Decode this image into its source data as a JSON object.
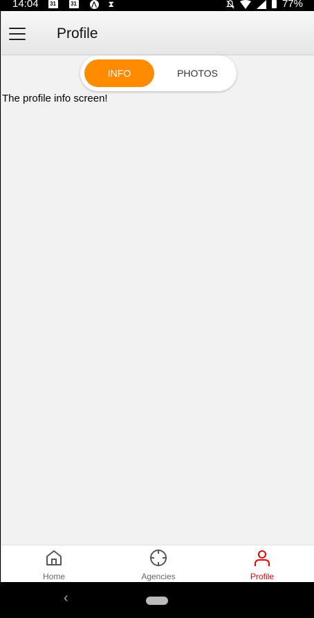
{
  "status_bar": {
    "time": "14:04",
    "calendar_1": "31",
    "calendar_2": "31",
    "battery": "77%"
  },
  "header": {
    "title": "Profile"
  },
  "tabs": {
    "info": "INFO",
    "photos": "PHOTOS",
    "selected": "INFO"
  },
  "content": {
    "text": "The profile info screen!"
  },
  "bottom_nav": {
    "items": [
      {
        "label": "Home",
        "icon": "home-icon"
      },
      {
        "label": "Agencies",
        "icon": "crosshair-icon"
      },
      {
        "label": "Profile",
        "icon": "user-icon"
      }
    ],
    "active": "Profile"
  },
  "colors": {
    "accent": "#ff8c00",
    "active_tab": "#dd0000"
  }
}
